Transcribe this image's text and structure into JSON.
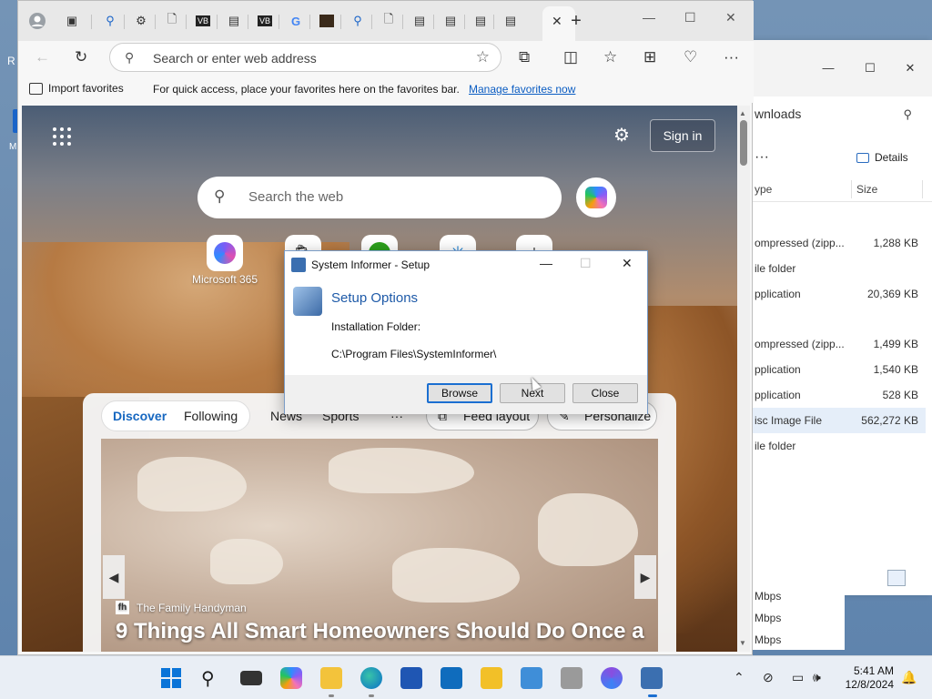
{
  "desktop": {
    "icon_letter_r": "R",
    "icon_letter_m": "M"
  },
  "browser": {
    "address_placeholder": "Search or enter web address",
    "favorites": {
      "import_label": "Import favorites",
      "message": "For quick access, place your favorites here on the favorites bar.",
      "manage_link": "Manage favorites now"
    },
    "new_tab": {
      "sign_in": "Sign in",
      "search_placeholder": "Search the web",
      "tile_label": "Microsoft 365",
      "feed_tabs": [
        "Discover",
        "Following",
        "News",
        "Sports"
      ],
      "more_label": "···",
      "feed_layout": "Feed layout",
      "personalize": "Personalize",
      "article": {
        "source_icon": "fh",
        "source": "The Family Handyman",
        "headline": "9 Things All Smart Homeowners Should Do Once a"
      }
    }
  },
  "dialog": {
    "title": "System Informer - Setup",
    "heading": "Setup Options",
    "folder_label": "Installation Folder:",
    "folder_path": "C:\\Program Files\\SystemInformer\\",
    "browse": "Browse",
    "next": "Next",
    "close": "Close"
  },
  "explorer": {
    "address": "wnloads",
    "details_label": "Details",
    "col_type": "ype",
    "col_size": "Size",
    "rows": [
      {
        "type": "ompressed (zipp...",
        "size": "1,288 KB"
      },
      {
        "type": "ile folder",
        "size": ""
      },
      {
        "type": "pplication",
        "size": "20,369 KB"
      },
      {
        "type": "ompressed (zipp...",
        "size": "1,499 KB"
      },
      {
        "type": "pplication",
        "size": "1,540 KB"
      },
      {
        "type": "pplication",
        "size": "528 KB"
      },
      {
        "type": "isc Image File",
        "size": "562,272 KB"
      },
      {
        "type": "ile folder",
        "size": ""
      }
    ]
  },
  "network_panel": [
    "Mbps",
    "Mbps",
    "Mbps"
  ],
  "taskbar": {
    "time": "5:41 AM",
    "date": "12/8/2024"
  },
  "colors": {
    "accent": "#1b6fd1",
    "link": "#0a5cc2",
    "dialog_heading": "#1e5aa8"
  }
}
